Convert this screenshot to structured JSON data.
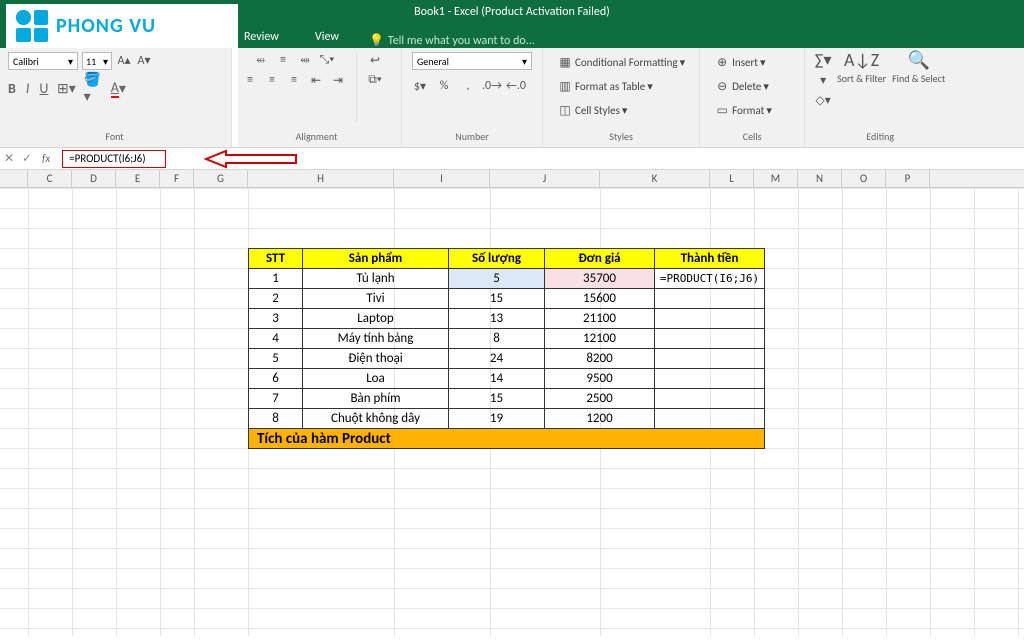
{
  "titlebar": {
    "title": "Book1 - Excel (Product Activation Failed)"
  },
  "tabs": {
    "review": "Review",
    "view": "View",
    "tellme": "Tell me what you want to do..."
  },
  "logo": {
    "text": "PHONG VU"
  },
  "ribbon": {
    "font": {
      "label": "Font",
      "family": "Calibri",
      "size": "11"
    },
    "alignment": {
      "label": "Alignment"
    },
    "number": {
      "label": "Number",
      "format": "General"
    },
    "styles": {
      "label": "Styles",
      "cond": "Conditional Formatting",
      "table": "Format as Table",
      "cell": "Cell Styles"
    },
    "cells": {
      "label": "Cells",
      "insert": "Insert",
      "delete": "Delete",
      "format": "Format"
    },
    "editing": {
      "label": "Editing",
      "sort": "Sort & Filter",
      "find": "Find & Select"
    }
  },
  "formula": {
    "value": "=PRODUCT(I6;J6)"
  },
  "columns": {
    "C": "C",
    "D": "D",
    "E": "E",
    "F": "F",
    "G": "G",
    "H": "H",
    "I": "I",
    "J": "J",
    "K": "K",
    "L": "L",
    "M": "M",
    "N": "N",
    "O": "O",
    "P": "P"
  },
  "table": {
    "headers": {
      "stt": "STT",
      "sp": "Sản phẩm",
      "sl": "Số lượng",
      "dg": "Đơn giá",
      "tt": "Thành tiền"
    },
    "rows": [
      {
        "stt": "1",
        "sp": "Tủ lạnh",
        "sl": "5",
        "dg": "35700",
        "tt": "=PRODUCT(I6;J6)"
      },
      {
        "stt": "2",
        "sp": "Tivi",
        "sl": "15",
        "dg": "15600",
        "tt": ""
      },
      {
        "stt": "3",
        "sp": "Laptop",
        "sl": "13",
        "dg": "21100",
        "tt": ""
      },
      {
        "stt": "4",
        "sp": "Máy tính bảng",
        "sl": "8",
        "dg": "12100",
        "tt": ""
      },
      {
        "stt": "5",
        "sp": "Điện thoại",
        "sl": "24",
        "dg": "8200",
        "tt": ""
      },
      {
        "stt": "6",
        "sp": "Loa",
        "sl": "14",
        "dg": "9500",
        "tt": ""
      },
      {
        "stt": "7",
        "sp": "Bàn phím",
        "sl": "15",
        "dg": "2500",
        "tt": ""
      },
      {
        "stt": "8",
        "sp": "Chuột không dây",
        "sl": "19",
        "dg": "1200",
        "tt": ""
      }
    ],
    "footer": "Tích của hàm Product"
  }
}
